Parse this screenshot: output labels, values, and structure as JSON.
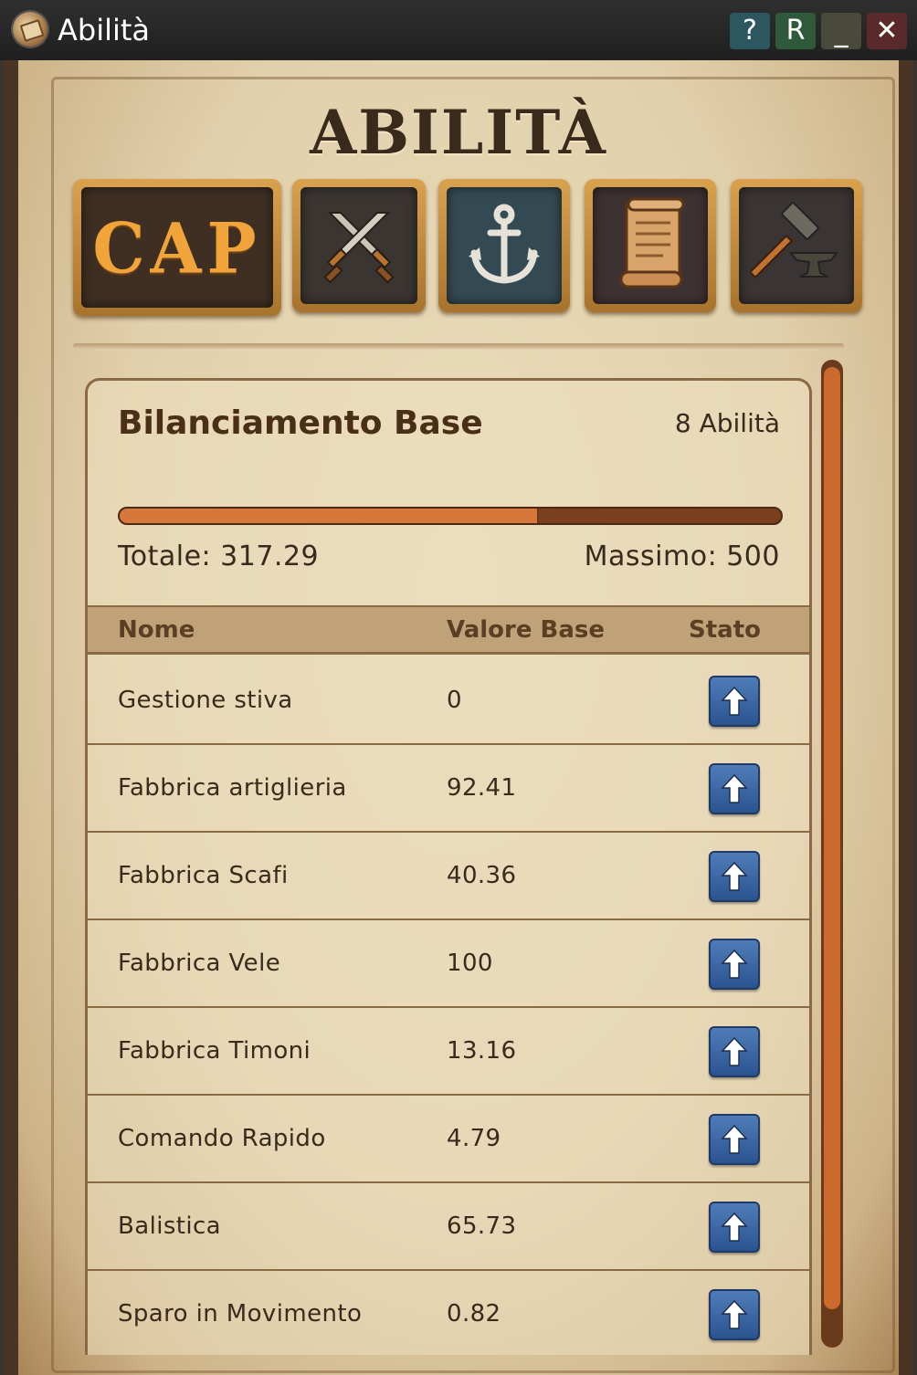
{
  "window": {
    "title": "Abilità",
    "buttons": {
      "help": "?",
      "refresh": "R",
      "minimize": "_",
      "close": "✕"
    }
  },
  "heading": "ABILITÀ",
  "tabs": [
    {
      "id": "cap",
      "label": "CAP",
      "icon": "cap-text",
      "active": true
    },
    {
      "id": "combat",
      "icon": "crossed-swords-icon"
    },
    {
      "id": "navigation",
      "icon": "anchor-icon"
    },
    {
      "id": "scroll",
      "icon": "scroll-icon"
    },
    {
      "id": "crafting",
      "icon": "hammer-anvil-icon"
    }
  ],
  "panel": {
    "title": "Bilanciamento Base",
    "count": "8 Abilità",
    "progress": 0.6346,
    "total_text": "Totale: 317.29",
    "max_text": "Massimo: 500"
  },
  "table": {
    "headers": {
      "name": "Nome",
      "value": "Valore Base",
      "status": "Stato"
    },
    "rows": [
      {
        "name": "Gestione stiva",
        "value": "0"
      },
      {
        "name": "Fabbrica artiglieria",
        "value": "92.41"
      },
      {
        "name": "Fabbrica Scafi",
        "value": "40.36"
      },
      {
        "name": "Fabbrica Vele",
        "value": "100"
      },
      {
        "name": "Fabbrica Timoni",
        "value": "13.16"
      },
      {
        "name": "Comando Rapido",
        "value": "4.79"
      },
      {
        "name": "Balistica",
        "value": "65.73"
      },
      {
        "name": "Sparo in Movimento",
        "value": "0.82"
      }
    ]
  },
  "colors": {
    "accent": "#d6773c",
    "button_blue": "#3b68a5",
    "tab_gold": "#d9a24e"
  }
}
